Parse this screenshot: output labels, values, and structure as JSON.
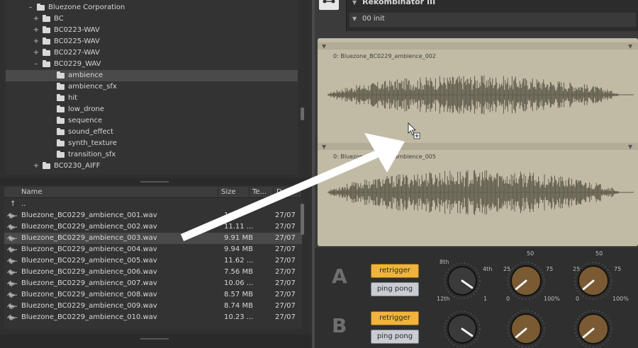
{
  "tree": {
    "items": [
      {
        "label": "Bluezone Corporation",
        "expander": "–",
        "depth": 0,
        "selected": false
      },
      {
        "label": "BC",
        "expander": "+",
        "depth": 1,
        "selected": false
      },
      {
        "label": "BC0223-WAV",
        "expander": "+",
        "depth": 1,
        "selected": false
      },
      {
        "label": "BC0225-WAV",
        "expander": "+",
        "depth": 1,
        "selected": false
      },
      {
        "label": "BC0227-WAV",
        "expander": "+",
        "depth": 1,
        "selected": false
      },
      {
        "label": "BC0229_WAV",
        "expander": "–",
        "depth": 1,
        "selected": false
      },
      {
        "label": "ambience",
        "expander": "",
        "depth": 2,
        "selected": true
      },
      {
        "label": "ambience_sfx",
        "expander": "",
        "depth": 2,
        "selected": false
      },
      {
        "label": "hit",
        "expander": "",
        "depth": 2,
        "selected": false
      },
      {
        "label": "low_drone",
        "expander": "",
        "depth": 2,
        "selected": false
      },
      {
        "label": "sequence",
        "expander": "",
        "depth": 2,
        "selected": false
      },
      {
        "label": "sound_effect",
        "expander": "",
        "depth": 2,
        "selected": false
      },
      {
        "label": "synth_texture",
        "expander": "",
        "depth": 2,
        "selected": false
      },
      {
        "label": "transition_sfx",
        "expander": "",
        "depth": 2,
        "selected": false
      },
      {
        "label": "BC0230_AIFF",
        "expander": "+",
        "depth": 1,
        "selected": false
      }
    ]
  },
  "file_list": {
    "columns": [
      "Name",
      "Size",
      "Te...",
      "D..."
    ],
    "up_label": "..",
    "rows": [
      {
        "name": "Bluezone_BC0229_ambience_001.wav",
        "size": "1...",
        "date": "27/07"
      },
      {
        "name": "Bluezone_BC0229_ambience_002.wav",
        "size": "11.11 ...",
        "date": "27/07"
      },
      {
        "name": "Bluezone_BC0229_ambience_003.wav",
        "size": "9.91 MB",
        "date": "27/07",
        "selected": true
      },
      {
        "name": "Bluezone_BC0229_ambience_004.wav",
        "size": "9.94 MB",
        "date": "27/07"
      },
      {
        "name": "Bluezone_BC0229_ambience_005.wav",
        "size": "11.62 ...",
        "date": "27/07"
      },
      {
        "name": "Bluezone_BC0229_ambience_006.wav",
        "size": "7.56 MB",
        "date": "27/07"
      },
      {
        "name": "Bluezone_BC0229_ambience_007.wav",
        "size": "10.06 ...",
        "date": "27/07"
      },
      {
        "name": "Bluezone_BC0229_ambience_008.wav",
        "size": "8.57 MB",
        "date": "27/07"
      },
      {
        "name": "Bluezone_BC0229_ambience_009.wav",
        "size": "8.74 MB",
        "date": "27/07"
      },
      {
        "name": "Bluezone_BC0229_ambience_010.wav",
        "size": "10.23 ...",
        "date": "27/07"
      }
    ]
  },
  "instrument": {
    "title": "Rekombinator III",
    "preset": "00 init"
  },
  "waveforms": [
    {
      "label": "0: Bluezone_BC0229_ambience_002"
    },
    {
      "label": "0: Bluezone_BC0229_ambience_005"
    }
  ],
  "controls": {
    "rows": [
      {
        "letter": "A",
        "retrigger": "retrigger",
        "pingpong": "ping pong"
      },
      {
        "letter": "B",
        "retrigger": "retrigger",
        "pingpong": "ping pong"
      }
    ],
    "knob_labels": {
      "k1": [
        "8th",
        "4th",
        "12th",
        "1"
      ],
      "k2": [
        "50",
        "25",
        "75",
        "0",
        "100%"
      ],
      "k3": [
        "50",
        "25",
        "75",
        "0",
        "100%"
      ]
    }
  },
  "colors": {
    "accent_yellow": "#f0b43a",
    "button_gray": "#c9ccd2",
    "wave_bg": "#c1bba6",
    "wave_color": "#5f5a4a",
    "arrow": "#ffffff"
  }
}
